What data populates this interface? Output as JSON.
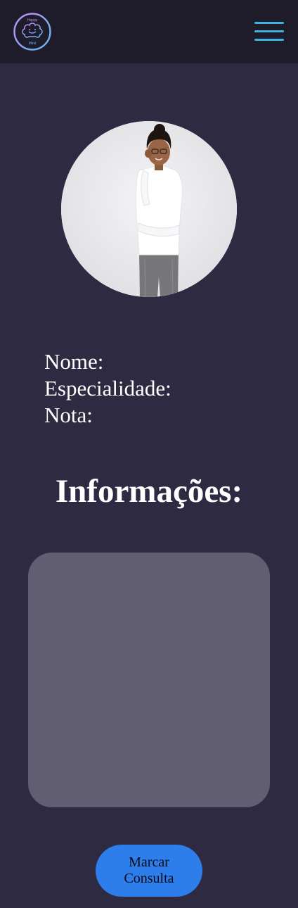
{
  "header": {
    "logo": {
      "icon": "happy-mind-brain-logo",
      "text_top": "Happy",
      "text_bottom": "Mind"
    },
    "menu": {
      "icon": "hamburger-menu-icon",
      "color": "#3fb3e0"
    }
  },
  "profile": {
    "photo": {
      "icon": "professional-woman-photo"
    },
    "fields": [
      "Nome:",
      "Especialidade:",
      "Nota:"
    ]
  },
  "info": {
    "title": "Informações:"
  },
  "action": {
    "label": "Marcar Consulta",
    "color": "#2d7deb"
  },
  "colors": {
    "background": "#2e2a41",
    "header": "#1e1b2a",
    "panel": "#615e72"
  }
}
